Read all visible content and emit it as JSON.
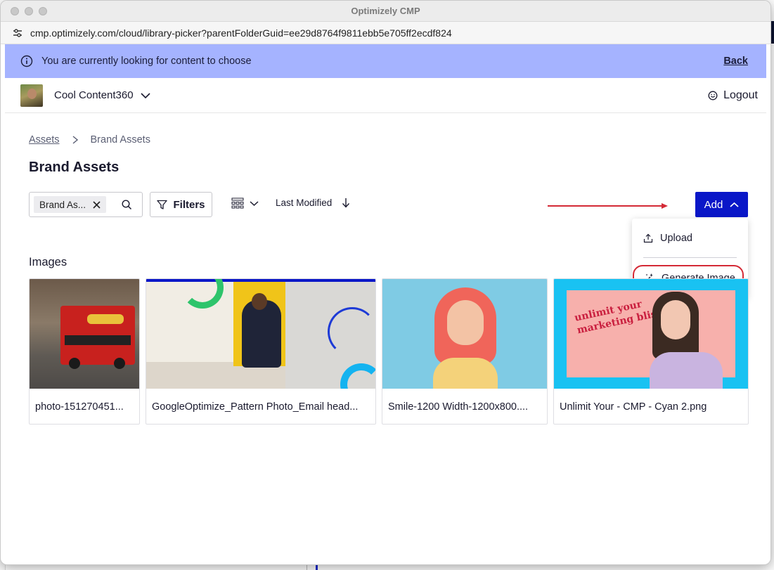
{
  "window": {
    "title": "Optimizely CMP",
    "url": "cmp.optimizely.com/cloud/library-picker?parentFolderGuid=ee29d8764f9811ebb5e705ff2ecdf824"
  },
  "banner": {
    "message": "You are currently looking for content to choose",
    "back_label": "Back",
    "color": "#a5b3ff"
  },
  "header": {
    "workspace": "Cool Content360",
    "logout_label": "Logout"
  },
  "breadcrumb": {
    "root": "Assets",
    "current": "Brand Assets"
  },
  "page_title": "Brand Assets",
  "toolbar": {
    "search_chip": "Brand As...",
    "filters_label": "Filters",
    "sort_label": "Last Modified",
    "add_label": "Add",
    "accent": "#0a17c8"
  },
  "add_menu": {
    "items": [
      {
        "label": "Upload",
        "icon": "upload-icon"
      },
      {
        "label": "Generate Image",
        "icon": "magic-wand-icon"
      }
    ]
  },
  "section_title": "Images",
  "assets": [
    {
      "name": "photo-151270451..."
    },
    {
      "name": "GoogleOptimize_Pattern Photo_Email head..."
    },
    {
      "name": "Smile-1200 Width-1200x800...."
    },
    {
      "name": "Unlimit Your - CMP - Cyan 2.png"
    }
  ],
  "thumbnail_text": {
    "unlimit_line1": "unlimit your",
    "unlimit_line2": "marketing bliss"
  }
}
